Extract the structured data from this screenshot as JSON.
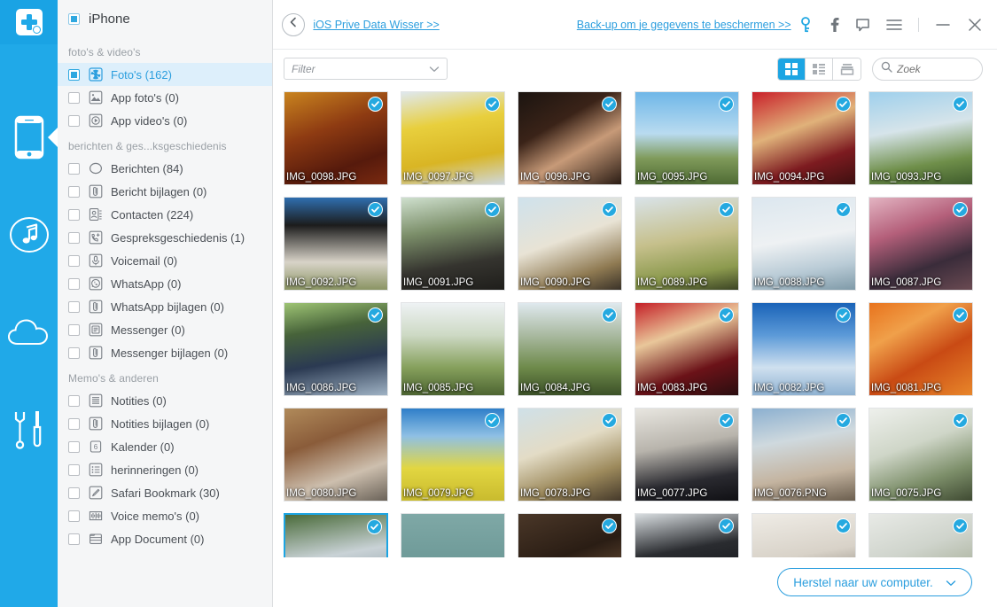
{
  "rail": {
    "logo_name": "app-logo",
    "items": [
      {
        "name": "device-phone",
        "icon": "phone-icon",
        "active": true
      },
      {
        "name": "itunes-backup",
        "icon": "music-note-icon",
        "active": false
      },
      {
        "name": "icloud-backup",
        "icon": "cloud-icon",
        "active": false
      },
      {
        "name": "toolkit",
        "icon": "wrench-screwdriver-icon",
        "active": false
      }
    ]
  },
  "titlebar": {
    "back_label": "back",
    "link_left": "iOS Prive Data Wisser  >>",
    "link_right": "Back-up om je gegevens te beschermen  >>",
    "icons": [
      "key-icon",
      "facebook-icon",
      "feedback-icon",
      "menu-icon",
      "minimize-icon",
      "close-icon"
    ]
  },
  "toolbar": {
    "filter_label": "Filter",
    "view_modes": [
      {
        "name": "view-grid-large",
        "active": true
      },
      {
        "name": "view-grid-list",
        "active": false
      },
      {
        "name": "view-stack",
        "active": false
      }
    ],
    "search_placeholder": "Zoek",
    "search_value": ""
  },
  "sidebar": {
    "device_label": "iPhone",
    "device_check": "partial",
    "groups": [
      {
        "title": "foto's & video's",
        "items": [
          {
            "label": "Foto's (162)",
            "icon": "photos-icon",
            "checked": true,
            "selected": true
          },
          {
            "label": "App foto's (0)",
            "icon": "app-photos-icon",
            "checked": false,
            "selected": false
          },
          {
            "label": "App video's (0)",
            "icon": "app-videos-icon",
            "checked": false,
            "selected": false
          }
        ]
      },
      {
        "title": "berichten & ges...ksgeschiedenis",
        "items": [
          {
            "label": "Berichten (84)",
            "icon": "messages-icon",
            "checked": false,
            "selected": false
          },
          {
            "label": "Bericht bijlagen (0)",
            "icon": "attachment-icon",
            "checked": false,
            "selected": false
          },
          {
            "label": "Contacten (224)",
            "icon": "contacts-icon",
            "checked": false,
            "selected": false
          },
          {
            "label": "Gespreksgeschiedenis (1)",
            "icon": "call-history-icon",
            "checked": false,
            "selected": false
          },
          {
            "label": "Voicemail (0)",
            "icon": "voicemail-icon",
            "checked": false,
            "selected": false
          },
          {
            "label": "WhatsApp (0)",
            "icon": "whatsapp-icon",
            "checked": false,
            "selected": false
          },
          {
            "label": "WhatsApp bijlagen (0)",
            "icon": "attachment-icon",
            "checked": false,
            "selected": false
          },
          {
            "label": "Messenger (0)",
            "icon": "messenger-icon",
            "checked": false,
            "selected": false
          },
          {
            "label": "Messenger bijlagen (0)",
            "icon": "attachment-icon",
            "checked": false,
            "selected": false
          }
        ]
      },
      {
        "title": "Memo's & anderen",
        "items": [
          {
            "label": "Notities (0)",
            "icon": "notes-icon",
            "checked": false,
            "selected": false
          },
          {
            "label": "Notities bijlagen (0)",
            "icon": "attachment-icon",
            "checked": false,
            "selected": false
          },
          {
            "label": "Kalender (0)",
            "icon": "calendar-icon",
            "checked": false,
            "selected": false
          },
          {
            "label": "herinneringen (0)",
            "icon": "reminders-icon",
            "checked": false,
            "selected": false
          },
          {
            "label": "Safari Bookmark (30)",
            "icon": "bookmark-icon",
            "checked": false,
            "selected": false
          },
          {
            "label": "Voice memo's (0)",
            "icon": "voice-memo-icon",
            "checked": false,
            "selected": false
          },
          {
            "label": "App Document (0)",
            "icon": "app-document-icon",
            "checked": false,
            "selected": false
          }
        ]
      }
    ]
  },
  "grid": {
    "items": [
      {
        "name": "IMG_0098.JPG",
        "checked": true,
        "focused": false,
        "art": "food-steak"
      },
      {
        "name": "IMG_0097.JPG",
        "checked": true,
        "focused": false,
        "art": "food-yellow"
      },
      {
        "name": "IMG_0096.JPG",
        "checked": true,
        "focused": false,
        "art": "child-portrait"
      },
      {
        "name": "IMG_0095.JPG",
        "checked": true,
        "focused": false,
        "art": "windmill-sky"
      },
      {
        "name": "IMG_0094.JPG",
        "checked": true,
        "focused": false,
        "art": "red-tulips-shop"
      },
      {
        "name": "IMG_0093.JPG",
        "checked": true,
        "focused": false,
        "art": "dutch-houses"
      },
      {
        "name": "IMG_0092.JPG",
        "checked": true,
        "focused": false,
        "art": "cows-field"
      },
      {
        "name": "IMG_0091.JPG",
        "checked": true,
        "focused": false,
        "art": "bikes-canal"
      },
      {
        "name": "IMG_0090.JPG",
        "checked": true,
        "focused": false,
        "art": "wedding-couple"
      },
      {
        "name": "IMG_0089.JPG",
        "checked": true,
        "focused": false,
        "art": "wedding-lawn"
      },
      {
        "name": "IMG_0088.JPG",
        "checked": true,
        "focused": false,
        "art": "couple-beach"
      },
      {
        "name": "IMG_0087.JPG",
        "checked": true,
        "focused": false,
        "art": "group-kids"
      },
      {
        "name": "IMG_0086.JPG",
        "checked": true,
        "focused": false,
        "art": "wedding-guests"
      },
      {
        "name": "IMG_0085.JPG",
        "checked": false,
        "focused": false,
        "art": "cyclists-meadow"
      },
      {
        "name": "IMG_0084.JPG",
        "checked": true,
        "focused": false,
        "art": "windmills-green"
      },
      {
        "name": "IMG_0083.JPG",
        "checked": true,
        "focused": false,
        "art": "flower-shop"
      },
      {
        "name": "IMG_0082.JPG",
        "checked": true,
        "focused": false,
        "art": "windmill-clouds"
      },
      {
        "name": "IMG_0081.JPG",
        "checked": true,
        "focused": false,
        "art": "orange-crowd"
      },
      {
        "name": "IMG_0080.JPG",
        "checked": false,
        "focused": false,
        "art": "street-town"
      },
      {
        "name": "IMG_0079.JPG",
        "checked": true,
        "focused": false,
        "art": "windmills-rapeseed"
      },
      {
        "name": "IMG_0078.JPG",
        "checked": true,
        "focused": false,
        "art": "bride-groom-run"
      },
      {
        "name": "IMG_0077.JPG",
        "checked": true,
        "focused": false,
        "art": "wedding-party"
      },
      {
        "name": "IMG_0076.PNG",
        "checked": true,
        "focused": false,
        "art": "bridesmaids"
      },
      {
        "name": "IMG_0075.JPG",
        "checked": true,
        "focused": false,
        "art": "white-bouquet"
      },
      {
        "name": "",
        "checked": true,
        "focused": true,
        "art": "canal-trees"
      },
      {
        "name": "",
        "checked": false,
        "focused": false,
        "art": "teal-sign"
      },
      {
        "name": "",
        "checked": true,
        "focused": false,
        "art": "dark-cave"
      },
      {
        "name": "",
        "checked": true,
        "focused": false,
        "art": "dark-crowd"
      },
      {
        "name": "",
        "checked": true,
        "focused": false,
        "art": "indoor-room"
      },
      {
        "name": "",
        "checked": true,
        "focused": false,
        "art": "bride-white"
      }
    ]
  },
  "footer": {
    "restore_label": "Herstel naar uw computer."
  },
  "colors": {
    "accent": "#20a9e8",
    "link": "#2b9ede",
    "selected_row": "#ddeffb",
    "sidebar_bg": "#f5f6f7"
  }
}
